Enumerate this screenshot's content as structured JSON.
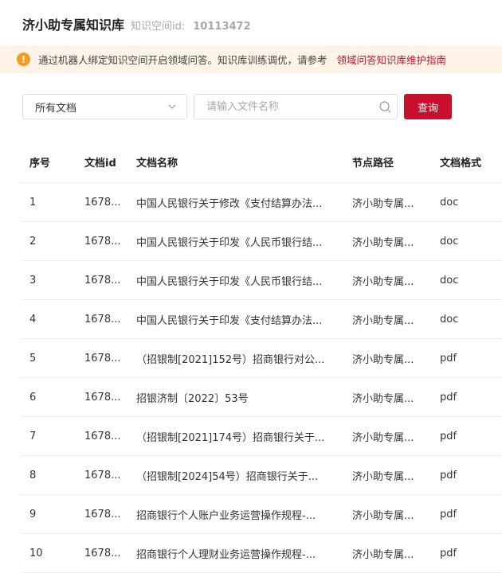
{
  "header": {
    "title": "济小助专属知识库",
    "id_label": "知识空间id:",
    "id_value": "10113472"
  },
  "notice": {
    "icon": "warning-icon",
    "text": "通过机器人绑定知识空间开启领域问答。知识库训练调优，请参考",
    "link": "领域问答知识库维护指南"
  },
  "filters": {
    "doc_select_value": "所有文档",
    "search_placeholder": "请输入文件名称",
    "query_button": "查询"
  },
  "table": {
    "columns": [
      "序号",
      "文档id",
      "文档名称",
      "节点路径",
      "文档格式"
    ],
    "rows": [
      [
        "1",
        "1678...",
        "中国人民银行关于修改《支付结算办法...",
        "济小助专属...",
        "doc"
      ],
      [
        "2",
        "1678...",
        "中国人民银行关于印发《人民币银行结...",
        "济小助专属...",
        "doc"
      ],
      [
        "3",
        "1678...",
        "中国人民银行关于印发《人民币银行结...",
        "济小助专属...",
        "doc"
      ],
      [
        "4",
        "1678...",
        "中国人民银行关于印发《支付结算办法...",
        "济小助专属...",
        "doc"
      ],
      [
        "5",
        "1678...",
        "（招银制[2021]152号）招商银行对公...",
        "济小助专属...",
        "pdf"
      ],
      [
        "6",
        "1678...",
        "招银济制〔2022〕53号",
        "济小助专属...",
        "pdf"
      ],
      [
        "7",
        "1678...",
        "（招银制[2021]174号）招商银行关于...",
        "济小助专属...",
        "pdf"
      ],
      [
        "8",
        "1678...",
        "（招银制[2024]54号）招商银行关于...",
        "济小助专属...",
        "pdf"
      ],
      [
        "9",
        "1678...",
        "招商银行个人账户业务运营操作规程-...",
        "济小助专属...",
        "pdf"
      ],
      [
        "10",
        "1678...",
        "招商银行个人理财业务运营操作规程-...",
        "济小助专属...",
        "pdf"
      ]
    ]
  },
  "colors": {
    "accent": "#c8102e",
    "notice_bg": "#fdf4e7",
    "warning": "#f59a23"
  }
}
